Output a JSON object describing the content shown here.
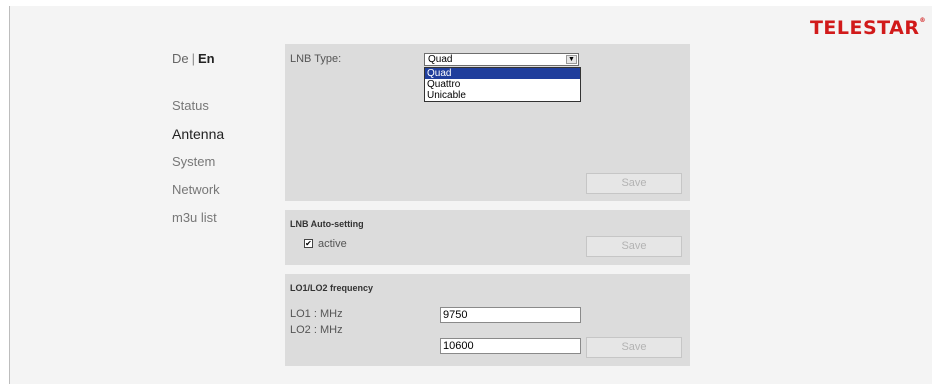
{
  "brand": {
    "logo_text": "TELESTAR",
    "logo_mark": "®",
    "color": "#d11a1a"
  },
  "language": {
    "de": "De",
    "separator": "|",
    "en": "En",
    "active": "En"
  },
  "nav": {
    "items": [
      {
        "label": "Status"
      },
      {
        "label": "Antenna",
        "current": true
      },
      {
        "label": "System"
      },
      {
        "label": "Network"
      },
      {
        "label": "m3u list"
      }
    ]
  },
  "lnb_type": {
    "label": "LNB Type:",
    "selected": "Quad",
    "options": [
      "Quad",
      "Quattro",
      "Unicable"
    ],
    "highlighted": "Quad",
    "save_label": "Save"
  },
  "auto_setting": {
    "heading": "LNB Auto-setting",
    "checkbox_label": "active",
    "checked": true,
    "save_label": "Save"
  },
  "lo_frequency": {
    "heading": "LO1/LO2 frequency",
    "lo1_label": "LO1 : MHz",
    "lo2_label": "LO2 : MHz",
    "lo1_value": "9750",
    "lo2_value": "10600",
    "save_label": "Save"
  },
  "colors": {
    "highlight": "#1f3e9c",
    "panel": "#dcdcdc"
  }
}
